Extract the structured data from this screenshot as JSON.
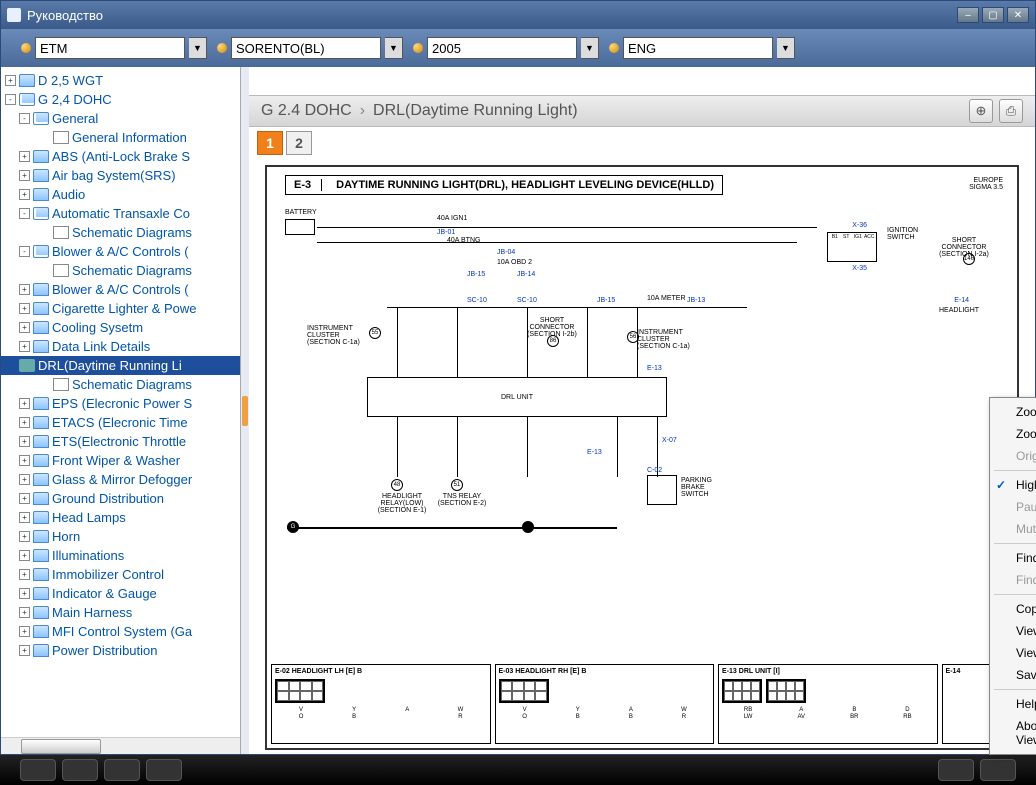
{
  "window": {
    "title": "Руководство"
  },
  "toolbar": {
    "selects": [
      {
        "value": "ETM"
      },
      {
        "value": "SORENTO(BL)"
      },
      {
        "value": "2005"
      },
      {
        "value": "ENG"
      }
    ]
  },
  "tree": [
    {
      "lvl": 0,
      "exp": "+",
      "ico": "folder-closed",
      "label": "D 2,5 WGT"
    },
    {
      "lvl": 0,
      "exp": "-",
      "ico": "folder-open",
      "label": "G 2,4 DOHC"
    },
    {
      "lvl": 1,
      "exp": "-",
      "ico": "folder-open",
      "label": "General"
    },
    {
      "lvl": 2,
      "exp": " ",
      "ico": "page",
      "label": "General Information"
    },
    {
      "lvl": 1,
      "exp": "+",
      "ico": "folder-closed",
      "label": "ABS (Anti-Lock Brake S"
    },
    {
      "lvl": 1,
      "exp": "+",
      "ico": "folder-closed",
      "label": "Air bag System(SRS)"
    },
    {
      "lvl": 1,
      "exp": "+",
      "ico": "folder-closed",
      "label": "Audio"
    },
    {
      "lvl": 1,
      "exp": "-",
      "ico": "folder-open",
      "label": "Automatic Transaxle Co"
    },
    {
      "lvl": 2,
      "exp": " ",
      "ico": "page",
      "label": "Schematic Diagrams"
    },
    {
      "lvl": 1,
      "exp": "-",
      "ico": "folder-open",
      "label": "Blower & A/C Controls ("
    },
    {
      "lvl": 2,
      "exp": " ",
      "ico": "page",
      "label": "Schematic Diagrams"
    },
    {
      "lvl": 1,
      "exp": "+",
      "ico": "folder-closed",
      "label": "Blower & A/C Controls ("
    },
    {
      "lvl": 1,
      "exp": "+",
      "ico": "folder-closed",
      "label": "Cigarette Lighter & Powe"
    },
    {
      "lvl": 1,
      "exp": "+",
      "ico": "folder-closed",
      "label": "Cooling Sysetm"
    },
    {
      "lvl": 1,
      "exp": "+",
      "ico": "folder-closed",
      "label": "Data Link Details"
    },
    {
      "lvl": 1,
      "exp": "-",
      "ico": "sel-ico",
      "label": "DRL(Daytime Running Li",
      "selected": true
    },
    {
      "lvl": 2,
      "exp": " ",
      "ico": "page",
      "label": "Schematic Diagrams"
    },
    {
      "lvl": 1,
      "exp": "+",
      "ico": "folder-closed",
      "label": "EPS (Elecronic Power S"
    },
    {
      "lvl": 1,
      "exp": "+",
      "ico": "folder-closed",
      "label": "ETACS (Elecronic Time"
    },
    {
      "lvl": 1,
      "exp": "+",
      "ico": "folder-closed",
      "label": "ETS(Electronic Throttle"
    },
    {
      "lvl": 1,
      "exp": "+",
      "ico": "folder-closed",
      "label": "Front Wiper & Washer"
    },
    {
      "lvl": 1,
      "exp": "+",
      "ico": "folder-closed",
      "label": "Glass & Mirror Defogger"
    },
    {
      "lvl": 1,
      "exp": "+",
      "ico": "folder-closed",
      "label": "Ground Distribution"
    },
    {
      "lvl": 1,
      "exp": "+",
      "ico": "folder-closed",
      "label": "Head Lamps"
    },
    {
      "lvl": 1,
      "exp": "+",
      "ico": "folder-closed",
      "label": "Horn"
    },
    {
      "lvl": 1,
      "exp": "+",
      "ico": "folder-closed",
      "label": "Illuminations"
    },
    {
      "lvl": 1,
      "exp": "+",
      "ico": "folder-closed",
      "label": "Immobilizer Control"
    },
    {
      "lvl": 1,
      "exp": "+",
      "ico": "folder-closed",
      "label": "Indicator & Gauge"
    },
    {
      "lvl": 1,
      "exp": "+",
      "ico": "folder-closed",
      "label": "Main Harness"
    },
    {
      "lvl": 1,
      "exp": "+",
      "ico": "folder-closed",
      "label": "MFI Control System (Ga"
    },
    {
      "lvl": 1,
      "exp": "+",
      "ico": "folder-closed",
      "label": "Power Distribution"
    }
  ],
  "breadcrumb": {
    "part1": "G 2.4 DOHC",
    "part2": "DRL(Daytime Running Light)"
  },
  "tabs": [
    "1",
    "2"
  ],
  "diagram": {
    "code": "E-3",
    "title": "DAYTIME RUNNING LIGHT(DRL), HEADLIGHT LEVELING DEVICE(HLLD)",
    "region": "EUROPE",
    "sigma": "SIGMA 3.5",
    "battery": "BATTERY",
    "fuses": {
      "ign1": "40A IGN1",
      "btng": "40A BTNG",
      "obd2": "10A OBD 2",
      "meter": "10A METER"
    },
    "refs": {
      "jb01": "JB-01",
      "jb04": "JB-04",
      "jb14": "JB-14",
      "jb15": "JB-15",
      "jb13": "JB-13",
      "sc10": "SC-10",
      "e13": "E-13",
      "e14": "E-14",
      "x07": "X-07",
      "x36": "X-36",
      "x35": "X-35",
      "c02": "C-02"
    },
    "components": {
      "ignition": "IGNITION SWITCH",
      "short_conn": "SHORT CONNECTOR (SECTION I-2a)",
      "short_conn2": "SHORT CONNECTOR (SECTION I-2b)",
      "inst_cluster1": "INSTRUMENT CLUSTER (SECTION C-1a)",
      "inst_cluster2": "INSTRUMENT CLUSTER (SECTION C-1a)",
      "drl_unit": "DRL UNIT",
      "headlight_relay": "HEADLIGHT RELAY(LOW) (SECTION E-1)",
      "tns_relay": "TNS RELAY (SECTION E-2)",
      "parking_brake": "PARKING BRAKE SWITCH",
      "headlight_assy": "HEADLIGHT"
    },
    "nodes": {
      "n48": "48",
      "n51": "51",
      "n55": "55",
      "n56": "56",
      "n86": "86",
      "n146": "146"
    },
    "ign_pins": [
      "B1",
      "ST",
      "IG1",
      "ACC"
    ],
    "connectors": [
      {
        "hdr": "E-02 HEADLIGHT LH [E] B",
        "pins": [
          "V",
          "Y",
          "A",
          "W",
          "O",
          "B",
          "R"
        ]
      },
      {
        "hdr": "E-03 HEADLIGHT RH [E] B",
        "pins": [
          "V",
          "Y",
          "A",
          "W",
          "O",
          "B",
          "B",
          "R"
        ]
      },
      {
        "hdr": "E-13 DRL UNIT [I]",
        "pins": [
          "RB",
          "A",
          "B",
          "D",
          "LW",
          "AV",
          "BR",
          "RB"
        ]
      },
      {
        "hdr": "E-14"
      }
    ]
  },
  "context_menu": [
    {
      "label": "Zoom In",
      "type": "item"
    },
    {
      "label": "Zoom Out",
      "type": "item"
    },
    {
      "label": "Original View",
      "type": "disabled"
    },
    {
      "type": "sep"
    },
    {
      "label": "Higher Quality",
      "type": "item",
      "checked": true
    },
    {
      "label": "Pause",
      "type": "disabled"
    },
    {
      "label": "Mute",
      "type": "disabled"
    },
    {
      "type": "sep"
    },
    {
      "label": "Find...",
      "type": "item"
    },
    {
      "label": "Find Again",
      "type": "disabled"
    },
    {
      "type": "sep"
    },
    {
      "label": "Copy SVG",
      "type": "item"
    },
    {
      "label": "View SVG",
      "type": "item"
    },
    {
      "label": "View Source",
      "type": "item"
    },
    {
      "label": "Save SVG As...",
      "type": "item"
    },
    {
      "type": "sep"
    },
    {
      "label": "Help",
      "type": "item"
    },
    {
      "label": "About Adobe SVG Viewer...",
      "type": "item"
    }
  ]
}
